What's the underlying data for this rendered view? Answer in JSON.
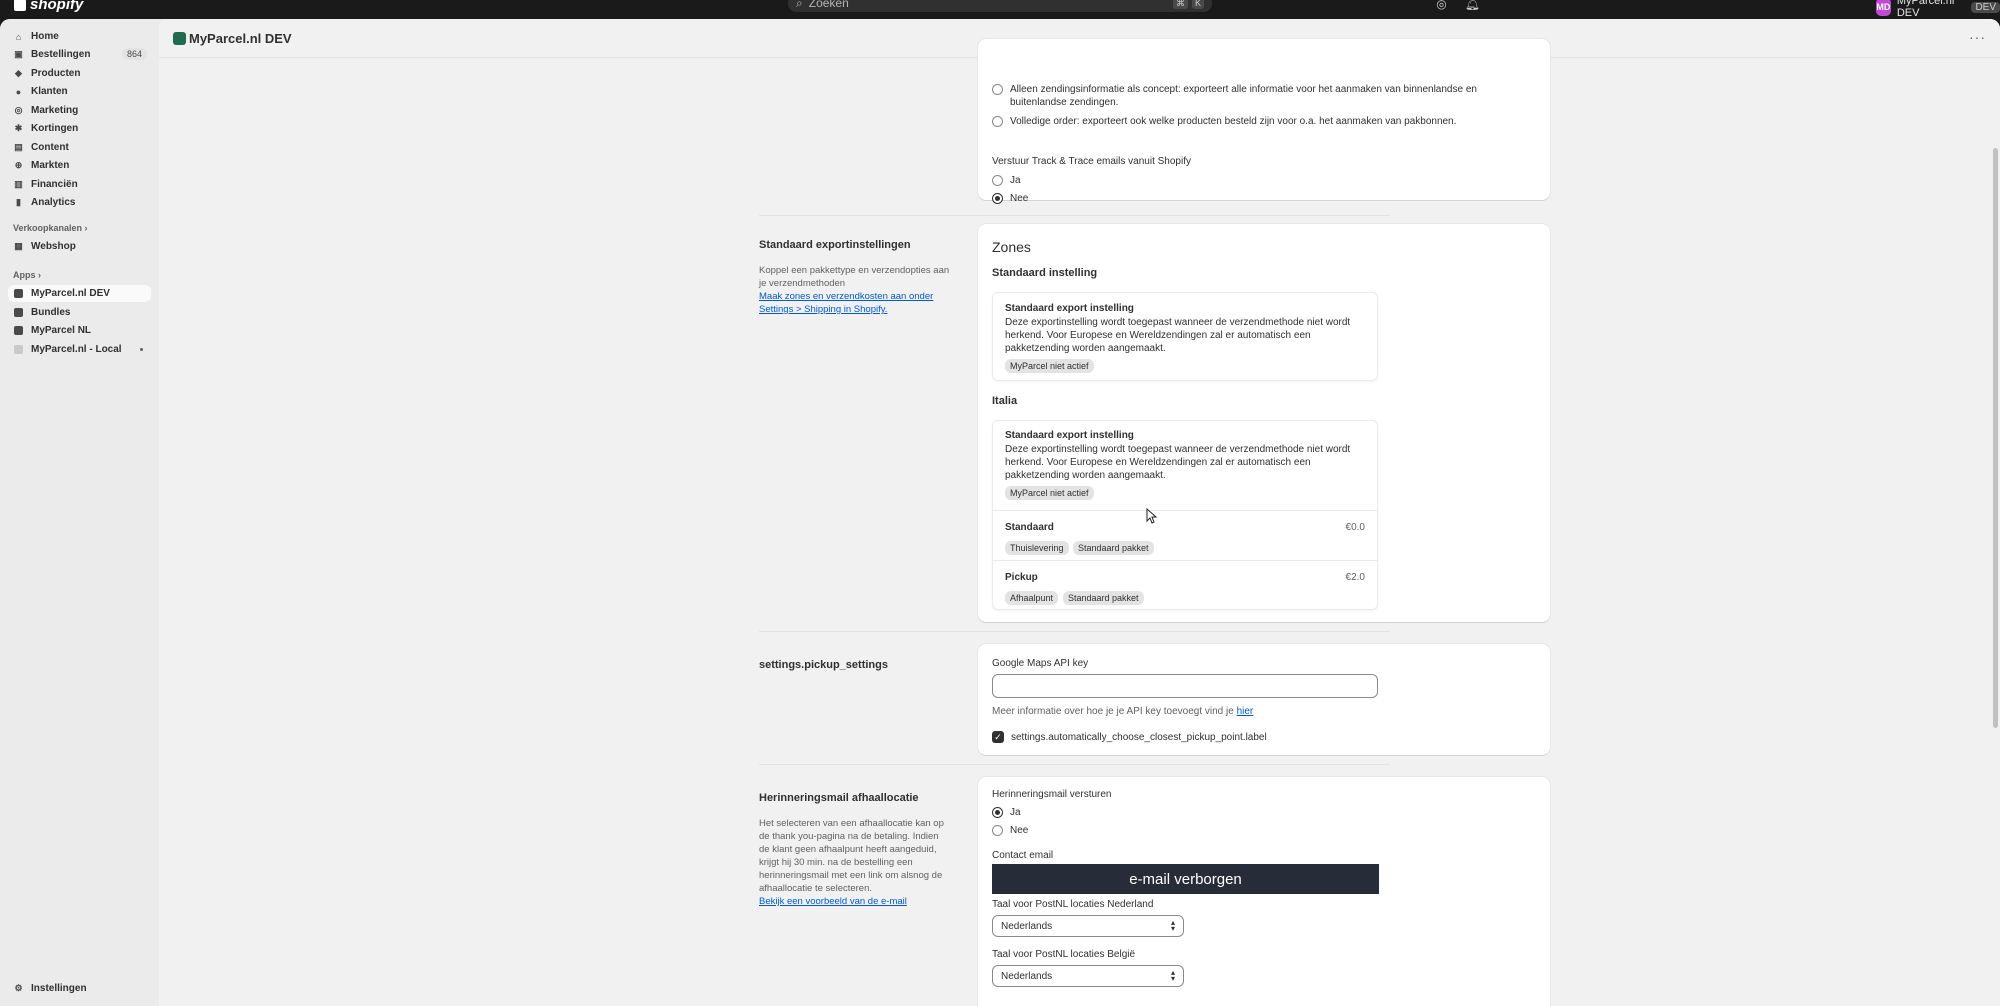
{
  "topbar": {
    "logo": "shopify",
    "search_placeholder": "Zoeken",
    "kbd1": "⌘",
    "kbd2": "K",
    "store_initials": "MD",
    "store_name": "MyParcel.nl DEV",
    "store_badge": "DEV"
  },
  "sidebar": {
    "items": [
      {
        "label": "Home",
        "icon": "home-icon"
      },
      {
        "label": "Bestellingen",
        "icon": "inbox-icon",
        "badge": "864"
      },
      {
        "label": "Producten",
        "icon": "tag-icon"
      },
      {
        "label": "Klanten",
        "icon": "person-icon"
      },
      {
        "label": "Marketing",
        "icon": "target-icon"
      },
      {
        "label": "Kortingen",
        "icon": "discount-icon"
      },
      {
        "label": "Content",
        "icon": "image-icon"
      },
      {
        "label": "Markten",
        "icon": "globe-icon"
      },
      {
        "label": "Financiën",
        "icon": "bank-icon"
      },
      {
        "label": "Analytics",
        "icon": "chart-icon"
      }
    ],
    "sales_channels_label": "Verkoopkanalen",
    "webshop_label": "Webshop",
    "apps_label": "Apps",
    "apps": [
      {
        "label": "MyParcel.nl DEV"
      },
      {
        "label": "Bundles"
      },
      {
        "label": "MyParcel NL"
      },
      {
        "label": "MyParcel.nl - Local"
      }
    ],
    "settings_label": "Instellingen"
  },
  "header": {
    "title": "MyParcel.nl DEV",
    "more": "···"
  },
  "export_top": {
    "option_concept": "Alleen zendingsinformatie als concept: exporteert alle informatie voor het aanmaken van binnenlandse en buitenlandse zendingen.",
    "option_full": "Volledige order: exporteert ook welke producten besteld zijn voor o.a. het aanmaken van pakbonnen.",
    "track_label": "Verstuur Track & Trace emails vanuit Shopify",
    "track_yes": "Ja",
    "track_no": "Nee"
  },
  "default_export": {
    "title": "Standaard exportinstellingen",
    "desc": "Koppel een pakkettype en verzendopties aan je verzendmethoden",
    "link": "Maak zones en verzendkosten aan onder Settings > Shipping in Shopify.",
    "zones_heading": "Zones",
    "default_heading": "Standaard instelling",
    "card_title": "Standaard export instelling",
    "card_text": "Deze exportinstelling wordt toegepast wanneer de verzendmethode niet wordt herkend. Voor Europese en Wereldzendingen zal er automatisch een pakketzending worden aangemaakt.",
    "inactive_tag": "MyParcel niet actief",
    "italia_heading": "Italia",
    "italia_card_title": "Standaard export instelling",
    "italia_card_text": "Deze exportinstelling wordt toegepast wanneer de verzendmethode niet wordt herkend. Voor Europese en Wereldzendingen zal er automatisch een pakketzending worden aangemaakt.",
    "italia_inactive_tag": "MyParcel niet actief",
    "rates": [
      {
        "name": "Standaard",
        "price": "€0.0",
        "tags": [
          "Thuislevering",
          "Standaard pakket"
        ]
      },
      {
        "name": "Pickup",
        "price": "€2.0",
        "tags": [
          "Afhaalpunt",
          "Standaard pakket"
        ]
      }
    ]
  },
  "pickup": {
    "title": "settings.pickup_settings",
    "api_label": "Google Maps API key",
    "api_value": "",
    "help_prefix": "Meer informatie over hoe je je API key toevoegt vind je",
    "help_link": "hier",
    "checkbox_label": "settings.automatically_choose_closest_pickup_point.label"
  },
  "reminder": {
    "title": "Herinneringsmail afhaallocatie",
    "desc": "Het selecteren van een afhaallocatie kan op de thank you-pagina na de betaling. Indien de klant geen afhaalpunt heeft aangeduid, krijgt hij 30 min. na de bestelling een herinneringsmail met een link om alsnog de afhaallocatie te selecteren.",
    "link": "Bekijk een voorbeeld van de e-mail",
    "send_label": "Herinneringsmail versturen",
    "yes": "Ja",
    "no": "Nee",
    "contact_label": "Contact email",
    "email_hidden": "e-mail verborgen",
    "lang_nl_label": "Taal voor PostNL locaties Nederland",
    "lang_nl_value": "Nederlands",
    "lang_be_label": "Taal voor PostNL locaties België",
    "lang_be_value": "Nederlands"
  }
}
